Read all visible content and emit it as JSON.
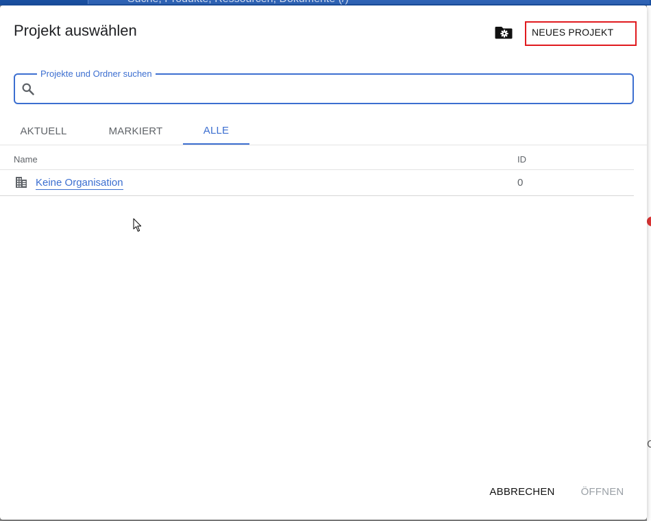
{
  "background": {
    "search_text": "Suche, Produkte, Ressourcen, Dokumente (/)"
  },
  "dialog": {
    "title": "Projekt auswählen",
    "folder_settings_icon": "folder-gear-icon",
    "new_project_label": "NEUES PROJEKT"
  },
  "search": {
    "label": "Projekte und Ordner suchen",
    "value": "",
    "placeholder": "",
    "icon": "search-icon"
  },
  "tabs": [
    {
      "label": "AKTUELL",
      "active": false
    },
    {
      "label": "MARKIERT",
      "active": false
    },
    {
      "label": "ALLE",
      "active": true
    }
  ],
  "table": {
    "columns": [
      "Name",
      "ID"
    ],
    "rows": [
      {
        "icon": "organization-building-icon",
        "name": "Keine Organisation",
        "id": "0"
      }
    ]
  },
  "footer": {
    "cancel_label": "ABBRECHEN",
    "open_label": "ÖFFNEN"
  },
  "colors": {
    "accent": "#3b6ed0",
    "highlight_border": "#e0181d",
    "disabled_text": "#9aa0a6"
  }
}
